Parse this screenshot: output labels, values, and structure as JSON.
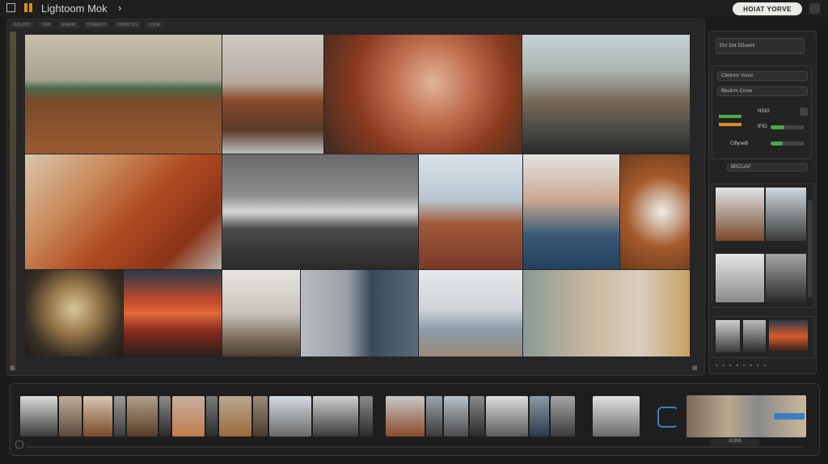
{
  "app": {
    "title": "Lightoom Mok",
    "mode_button": "HOIAT YORVE"
  },
  "tabs": [
    "SOLOTO",
    "CAN",
    "EXAND",
    "STREETO",
    "CONSTILS",
    "LOOK"
  ],
  "right_panel": {
    "header_value": "Etrr Dot 5Ooeml",
    "section1_label": "Cilotrom Yonut",
    "section2_label": "Bbuitrm Cmoe",
    "control_labels": [
      "NSIO",
      "IFIO",
      "CiflyoeB"
    ],
    "zoom_label": "BRCUAF"
  },
  "filmstrip": {
    "counter_label": "B2BB"
  },
  "colors": {
    "accent": "#4aa94a",
    "button_bg": "#e9e9e6",
    "bg": "#1b1b1b",
    "panel": "#262626",
    "progress": "#3a7fc2"
  },
  "icons": {
    "window": "window-icon",
    "flag": "flag-icon",
    "chevron": "chevron-right-icon",
    "grid": "grid-icon",
    "spinner": "spinner-icon"
  }
}
